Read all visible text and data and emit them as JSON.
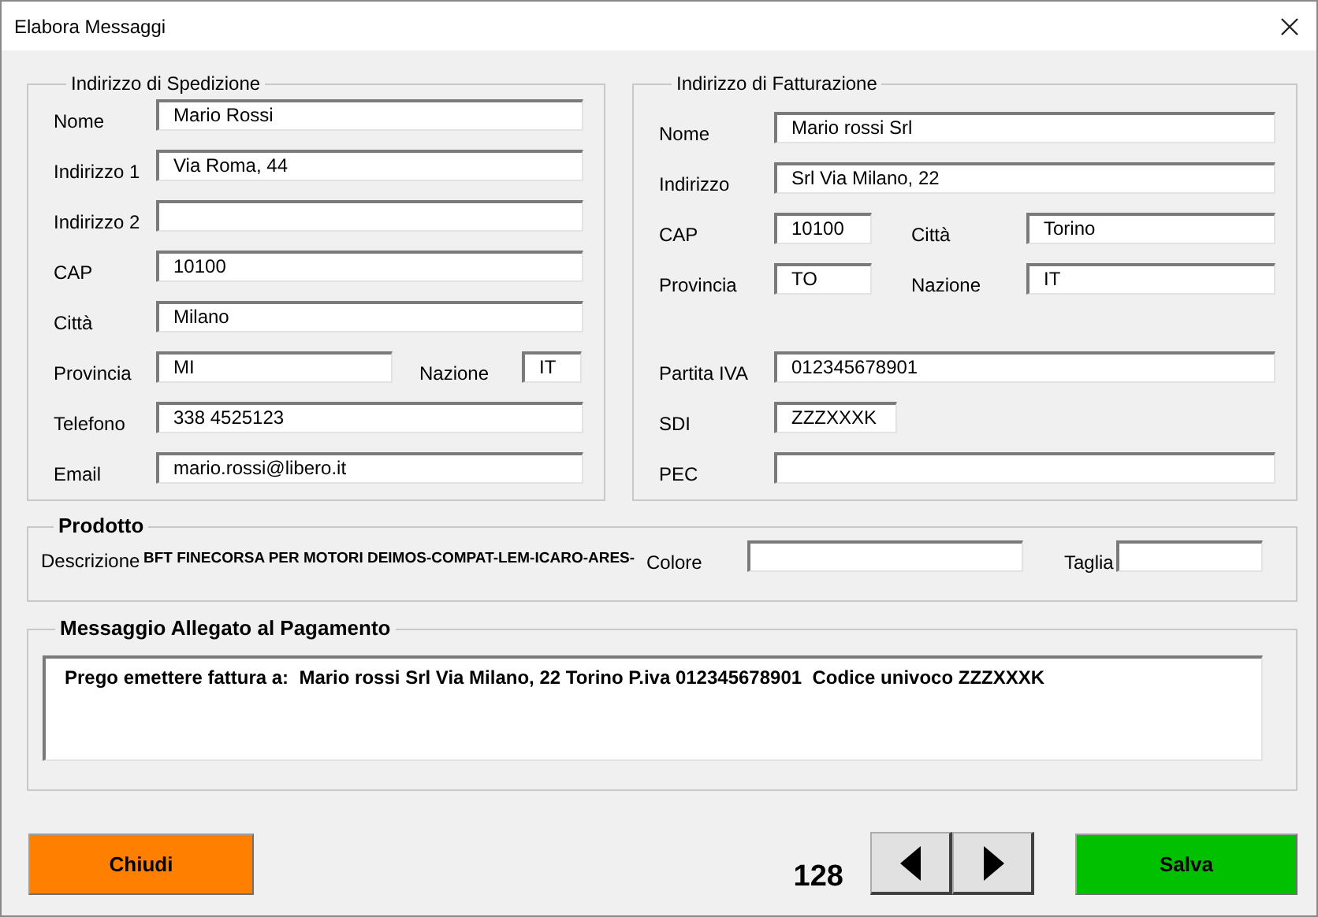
{
  "window": {
    "title": "Elabora Messaggi"
  },
  "shipping": {
    "legend": "Indirizzo di Spedizione",
    "rows": [
      [
        {
          "label": "Nome",
          "value": "Mario Rossi",
          "kind": "wide"
        }
      ],
      [
        {
          "label": "Indirizzo 1",
          "value": "Via Roma, 44",
          "kind": "wide"
        }
      ],
      [
        {
          "label": "Indirizzo 2",
          "kind": "wide"
        }
      ],
      [
        {
          "label": "CAP",
          "value": "10100",
          "kind": "wide"
        }
      ],
      [
        {
          "label": "Città",
          "value": "Milano",
          "kind": "wide"
        }
      ],
      [
        {
          "label": "Provincia",
          "value": "MI",
          "kind": "half"
        },
        {
          "label": "Nazione",
          "value": "IT",
          "kind": "tiny"
        }
      ],
      [
        {
          "label": "Telefono",
          "value": "338 4525123",
          "kind": "wide"
        }
      ],
      [
        {
          "label": "Email",
          "value": "mario.rossi@libero.it",
          "kind": "wide"
        }
      ]
    ]
  },
  "billing": {
    "legend": "Indirizzo di Fatturazione",
    "rows": [
      [
        {
          "label": "Nome",
          "value": "Mario rossi Srl",
          "kind": "wide"
        }
      ],
      [
        {
          "label": "Indirizzo",
          "value": "Srl Via Milano, 22",
          "kind": "wide"
        }
      ],
      [
        {
          "label": "CAP",
          "value": "10100",
          "kind": "short"
        },
        {
          "label": "Città",
          "value": "Torino",
          "kind": "wide"
        }
      ],
      [
        {
          "label": "Provincia",
          "value": "TO",
          "kind": "short"
        },
        {
          "label": "Nazione",
          "value": "IT",
          "kind": "wide"
        }
      ],
      [
        {
          "label": "Partita IVA",
          "value": "012345678901",
          "kind": "wide"
        }
      ],
      [
        {
          "label": "SDI",
          "value": "ZZZXXXK",
          "kind": "code"
        }
      ],
      [
        {
          "label": "PEC",
          "kind": "wide"
        }
      ]
    ]
  },
  "product": {
    "legend": "Prodotto",
    "description_label": "Descrizione",
    "description": "BFT FINECORSA PER MOTORI DEIMOS-COMPAT-LEM-ICARO-ARES-",
    "color_label": "Colore",
    "size_label": "Taglia"
  },
  "message": {
    "legend": "Messaggio Allegato al Pagamento",
    "text": "Prego emettere fattura a:  Mario rossi Srl Via Milano, 22 Torino P.iva 012345678901  Codice univoco ZZZXXXK"
  },
  "footer": {
    "close_button": "Chiudi",
    "counter": "128",
    "save_button": "Salva"
  }
}
